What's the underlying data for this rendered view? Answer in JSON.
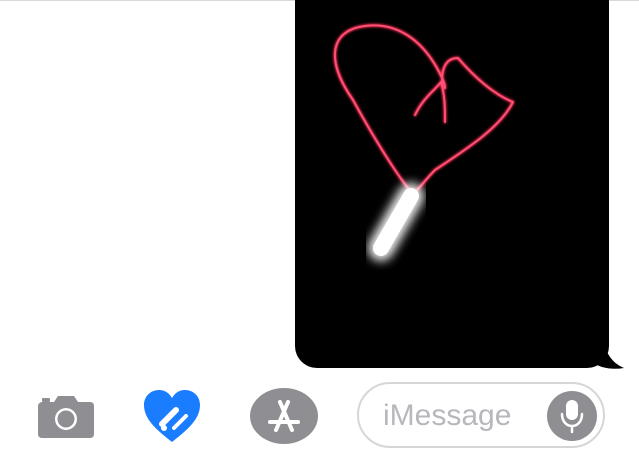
{
  "conversation": {
    "message": {
      "type": "digital-touch-sketch",
      "sketch_subject": "heart",
      "bubble_color": "#000000",
      "ink_color": "#ff2d55"
    }
  },
  "toolbar": {
    "camera_icon": "camera-icon",
    "digital_touch_icon": "digital-touch-heart-icon",
    "digital_touch_color": "#1a7cff",
    "app_store_icon": "app-store-icon",
    "icon_color": "#8e8e93"
  },
  "compose": {
    "placeholder": "iMessage",
    "mic_icon": "microphone-icon"
  }
}
